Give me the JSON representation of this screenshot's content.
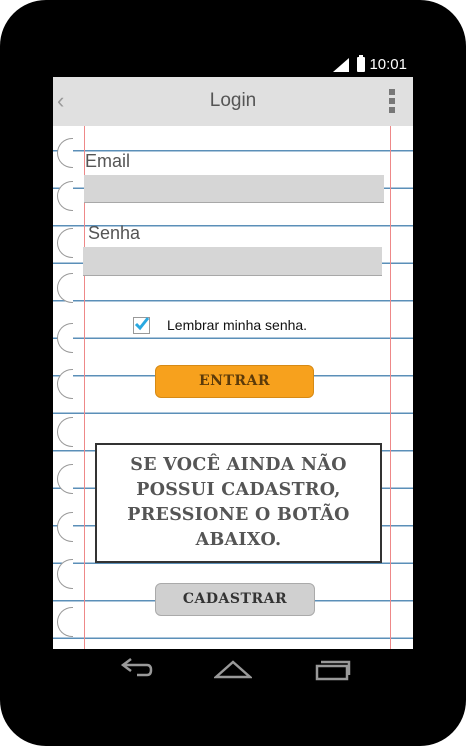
{
  "status_bar": {
    "time": "10:01"
  },
  "appbar": {
    "title": "Login",
    "back_icon": "chevron-left-icon",
    "menu_icon": "overflow-menu-icon"
  },
  "form": {
    "email_label": "Email",
    "email_value": "",
    "password_label": "Senha",
    "password_value": "",
    "remember_label": "Lembrar minha senha.",
    "remember_checked": true,
    "submit_label": "ENTRAR"
  },
  "notice": {
    "text": "Se você ainda não possui cadastro, pressione o botão abaixo."
  },
  "register_label": "CADASTRAR",
  "nav_bar": {
    "icons": [
      "back-icon",
      "home-icon",
      "recents-icon"
    ]
  },
  "colors": {
    "primary_button": "#f7a11d",
    "secondary_button": "#d0d0d0",
    "notebook_line": "#5b8fb8",
    "margin_line": "#e88888",
    "check": "#29a8e0"
  }
}
